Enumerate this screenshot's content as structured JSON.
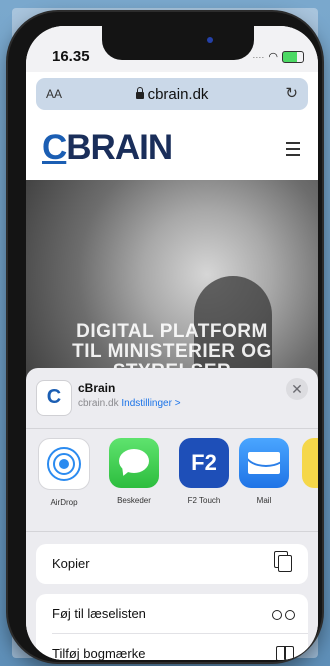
{
  "status_bar": {
    "time": "16.35"
  },
  "browser": {
    "text_size_label": "AA",
    "url": "cbrain.dk",
    "reload_glyph": "↻"
  },
  "site": {
    "logo_first": "C",
    "logo_rest": "BRAIN",
    "hero_line1": "DIGITAL PLATFORM",
    "hero_line2": "TIL MINISTERIER OG",
    "hero_line3": "STYRELSER"
  },
  "share_sheet": {
    "site_icon_letter": "C",
    "site_name": "cBrain",
    "site_domain": "cbrain.dk",
    "options_link": "Indstillinger >",
    "close_glyph": "✕",
    "apps": [
      {
        "name": "airdrop",
        "label": "AirDrop"
      },
      {
        "name": "messages",
        "label": "Beskeder"
      },
      {
        "name": "f2-touch",
        "label": "F2 Touch",
        "icon_text": "F2"
      },
      {
        "name": "mail",
        "label": "Mail"
      }
    ],
    "actions": [
      {
        "label": "Kopier",
        "icon": "copy-icon"
      },
      {
        "label": "Føj til læselisten",
        "icon": "glasses-icon"
      },
      {
        "label": "Tilføj bogmærke",
        "icon": "book-icon"
      }
    ]
  },
  "colors": {
    "accent_blue": "#1a73e8",
    "brand_blue": "#1b5eb3",
    "logo_navy": "#1a2e5a"
  }
}
